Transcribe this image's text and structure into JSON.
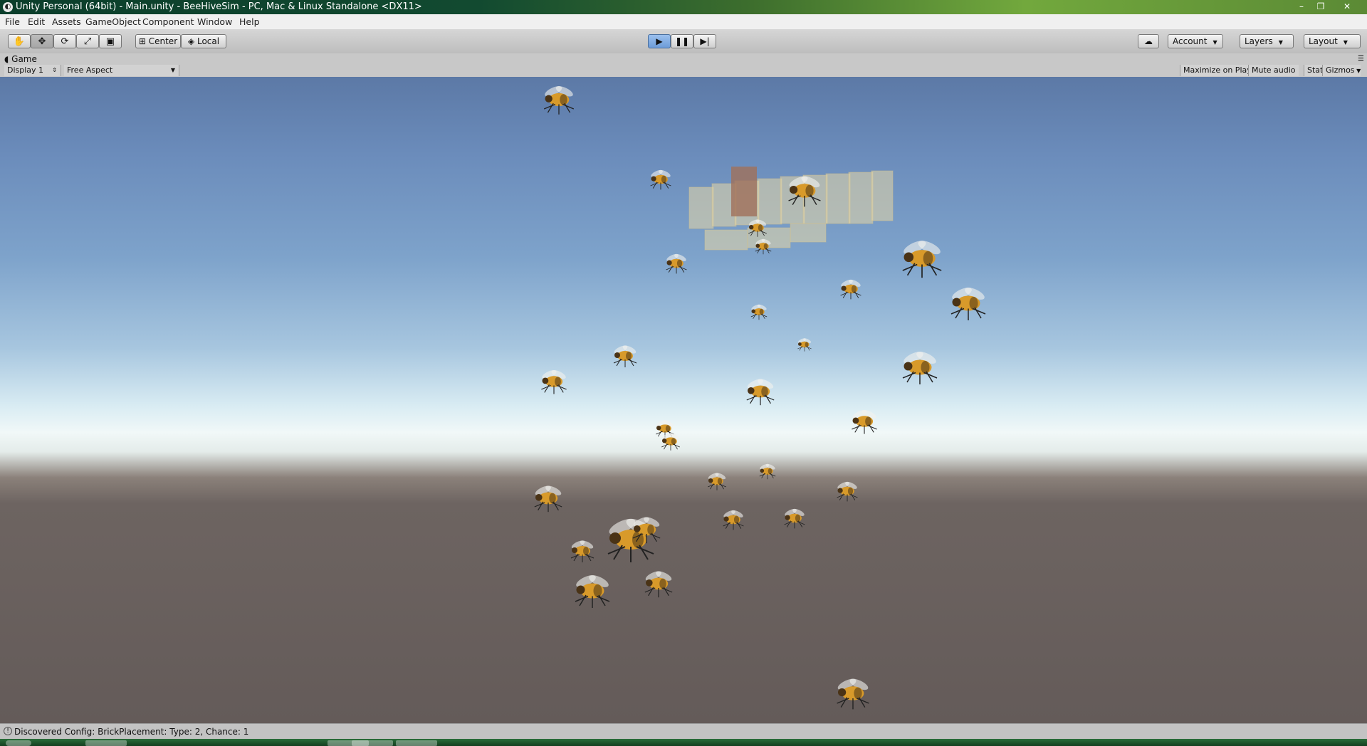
{
  "window": {
    "title": "Unity Personal (64bit) - Main.unity - BeeHiveSim - PC, Mac & Linux Standalone <DX11>",
    "controls": [
      "–",
      "❐",
      "✕"
    ]
  },
  "menu": [
    "File",
    "Edit",
    "Assets",
    "GameObject",
    "Component",
    "Window",
    "Help"
  ],
  "toolbar": {
    "tools": [
      {
        "name": "hand-tool",
        "glyph": "✋"
      },
      {
        "name": "move-tool",
        "glyph": "✥"
      },
      {
        "name": "rotate-tool",
        "glyph": "⟳"
      },
      {
        "name": "scale-tool",
        "glyph": "⤢"
      },
      {
        "name": "rect-tool",
        "glyph": "▣"
      }
    ],
    "active_tool": "move-tool",
    "pivot_label": "Center",
    "space_label": "Local",
    "play_glyph": "▶",
    "pause_glyph": "❚❚",
    "step_glyph": "▶|",
    "cloud_glyph": "☁",
    "account_label": "Account",
    "layers_label": "Layers",
    "layout_label": "Layout"
  },
  "game_view": {
    "tab_label": "Game",
    "display_select": "Display 1",
    "aspect_select": "Free Aspect",
    "maximize_on_play": "Maximize on Play",
    "mute_audio": "Mute audio",
    "stats": "Stats",
    "gizmos": "Gizmos"
  },
  "status": {
    "message": "Discovered Config: BrickPlacement: Type: 2, Chance: 1"
  }
}
